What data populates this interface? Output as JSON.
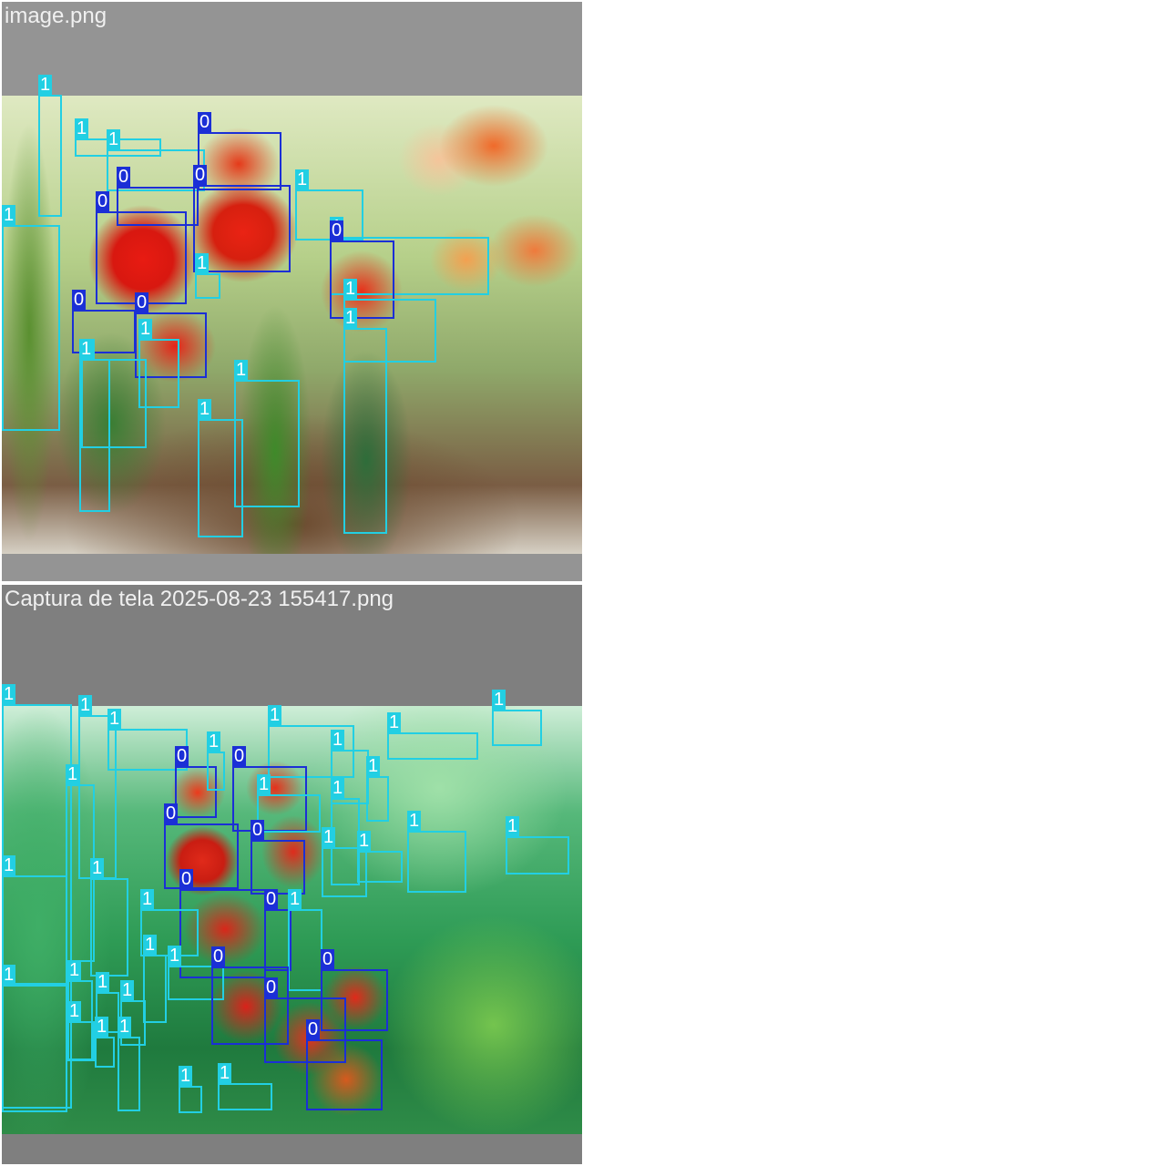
{
  "colors": {
    "class_0": "#1b2fd6",
    "class_1": "#22cfe3"
  },
  "panels": [
    {
      "filename": "image.png",
      "class_labels": {
        "c0": "0",
        "c1": "1"
      }
    },
    {
      "filename": "Captura de tela 2025-08-23 155417.png",
      "class_labels": {
        "c0": "0",
        "c1": "1"
      }
    }
  ]
}
